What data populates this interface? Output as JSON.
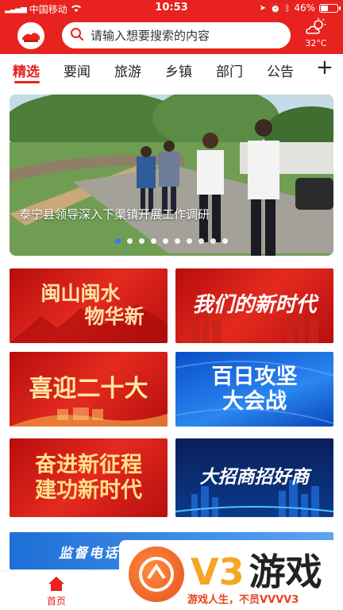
{
  "status_bar": {
    "carrier": "中国移动",
    "time": "10:53",
    "battery": "46%",
    "battery_level": 0.46
  },
  "header": {
    "search_placeholder": "请输入想要搜索的内容",
    "weather_temp": "32°C"
  },
  "tabs": [
    {
      "label": "精选",
      "active": true
    },
    {
      "label": "要闻"
    },
    {
      "label": "旅游"
    },
    {
      "label": "乡镇"
    },
    {
      "label": "部门"
    },
    {
      "label": "公告"
    }
  ],
  "banner": {
    "caption": "泰宁县领导深入下渠镇开展工作调研",
    "slide_count": 10,
    "active_slide": 1
  },
  "cards": [
    {
      "line1": "闽山闽水",
      "line2": "物华新"
    },
    {
      "line1": "我们的新时代"
    },
    {
      "line1": "喜迎二十大"
    },
    {
      "line1": "百日攻坚",
      "line2": "大会战"
    },
    {
      "line1": "奋进新征程",
      "line2": "建功新时代"
    },
    {
      "line1": "大招商招好商"
    }
  ],
  "strip": {
    "text": "监督电话"
  },
  "tabbar": {
    "home_label": "首页"
  },
  "watermark": {
    "title_v3": "V3",
    "title_cn": "游戏",
    "subtitle": "游戏人生，不员VVVV3"
  }
}
